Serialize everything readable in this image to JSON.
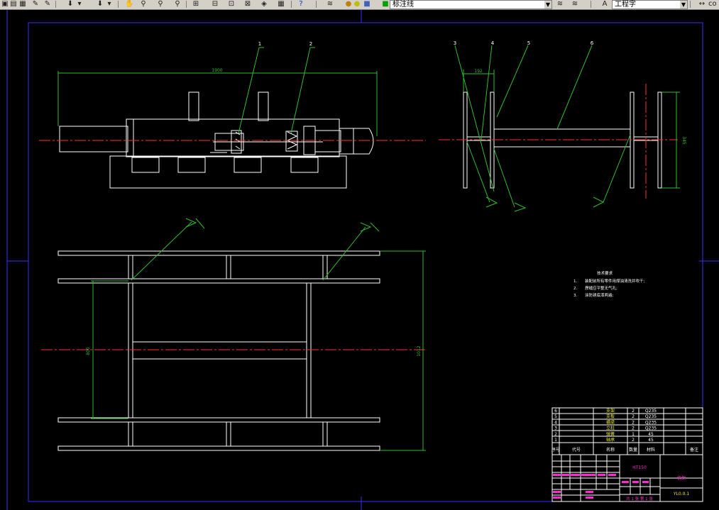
{
  "toolbar": {
    "layer_name": "标注线",
    "text_style": "工程字",
    "right_label": "co"
  },
  "drawing": {
    "top_view": {
      "part_labels": [
        "1",
        "2"
      ],
      "dim_length": "1900"
    },
    "side_view": {
      "part_labels": [
        "3",
        "4",
        "5",
        "6"
      ],
      "dim_width": "192",
      "dim_height": "345"
    },
    "front_view": {
      "dim_inner": "800",
      "dim_outer": "1012"
    },
    "notes": {
      "title": "技术要求",
      "items": [
        {
          "num": "1.",
          "text": "装配前所有零件用煤油清洗并吹干;"
        },
        {
          "num": "2.",
          "text": "焊缝应平整无气孔;"
        },
        {
          "num": "3.",
          "text": "涂防锈底漆两遍;"
        }
      ]
    },
    "bom": {
      "rows": [
        {
          "no": "6",
          "name": "支架",
          "qty": "2",
          "material": "Q235"
        },
        {
          "no": "5",
          "name": "支板",
          "qty": "2",
          "material": "Q235"
        },
        {
          "no": "4",
          "name": "横梁",
          "qty": "2",
          "material": "Q235"
        },
        {
          "no": "3",
          "name": "立柱",
          "qty": "2",
          "material": "Q235"
        },
        {
          "no": "2",
          "name": "弹簧",
          "qty": "1",
          "material": "45"
        },
        {
          "no": "1",
          "name": "轴承",
          "qty": "2",
          "material": "45"
        }
      ],
      "header": {
        "no": "序号",
        "code": "代号",
        "name": "名称",
        "qty": "数量",
        "material": "材料",
        "note": "备注"
      }
    },
    "title_block": {
      "material": "HT150",
      "drawing_name": "机架",
      "drawing_no": "YL0.0.1",
      "sheet": "共 1 张 第 1 张"
    }
  },
  "colors": {
    "line_white": "#ffffff",
    "center_red": "#ff3030",
    "dim_green": "#2ebd2e",
    "frame_blue": "#3030ff",
    "table_magenta": "#ff2bd0",
    "table_yellow": "#e8e820"
  }
}
